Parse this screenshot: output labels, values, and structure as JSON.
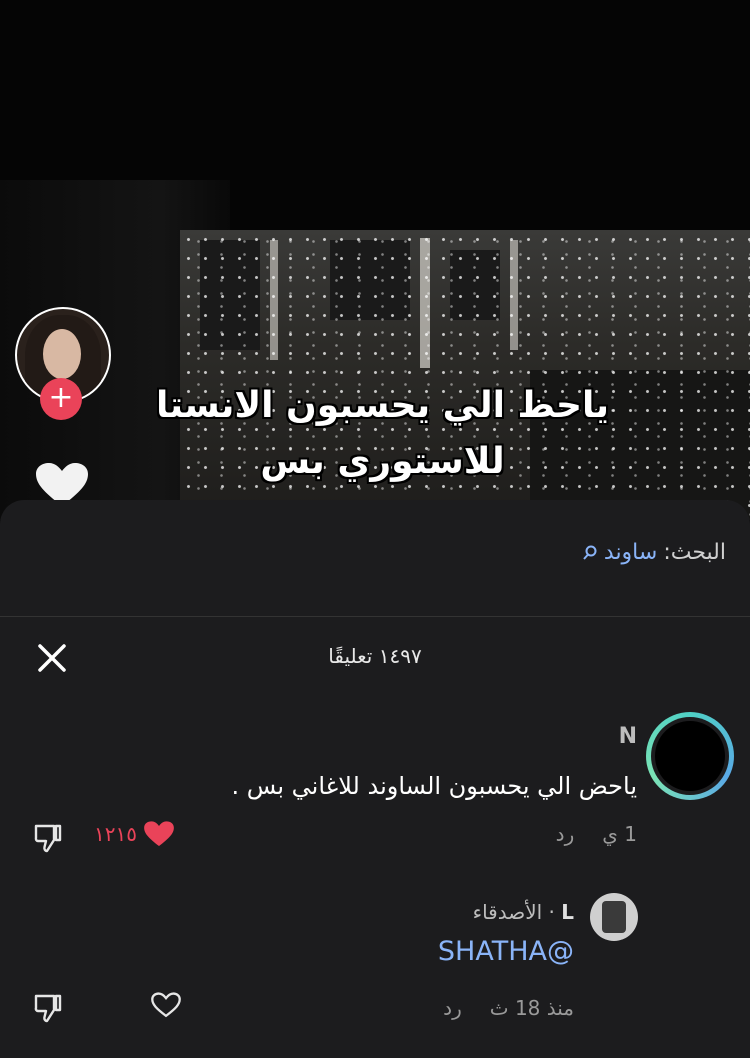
{
  "video": {
    "caption_line1": "ياحظ الي يحسبون الانستا",
    "caption_line2": "للاستوري بس"
  },
  "search": {
    "label": "البحث:",
    "term": "ساوند"
  },
  "comments_header": {
    "count_label": "١٤٩٧ تعليقًا"
  },
  "comments": [
    {
      "author": "N",
      "text": "ياحض الي يحسبون الساوند للاغاني بس .",
      "time": "1 ي",
      "reply_label": "رد",
      "likes": "١٢١٥"
    },
    {
      "author": "L",
      "author_suffix": "· الأصدقاء",
      "text": "SHATHA@",
      "time": "منذ 18 ث",
      "reply_label": "رد"
    }
  ],
  "colors": {
    "accent_red": "#ea4359",
    "link_blue": "#8ab4f8",
    "sheet_bg": "#1c1c1e"
  }
}
